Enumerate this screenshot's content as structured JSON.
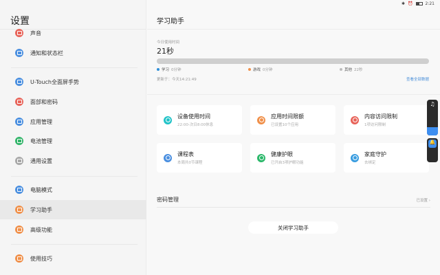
{
  "status": {
    "time": "2:21",
    "icons": [
      "wifi-icon",
      "app-icon",
      "app-icon",
      "app-icon"
    ],
    "right_icons": [
      "bluetooth-icon",
      "alarm-icon",
      "battery-icon"
    ]
  },
  "sidebar": {
    "title": "设置",
    "items": [
      {
        "label": "声音",
        "color": "#e8645a"
      },
      {
        "label": "通知和状态栏",
        "color": "#4a8fe0"
      },
      {
        "label": "U-Touch全面屏手势",
        "color": "#4a8fe0"
      },
      {
        "label": "面部和密码",
        "color": "#e8645a"
      },
      {
        "label": "应用管理",
        "color": "#4a8fe0"
      },
      {
        "label": "电池管理",
        "color": "#33b56a"
      },
      {
        "label": "通用设置",
        "color": "#a8a8a8"
      },
      {
        "label": "电脑模式",
        "color": "#4a8fe0"
      },
      {
        "label": "学习助手",
        "color": "#f0904a"
      },
      {
        "label": "高级功能",
        "color": "#f0904a"
      },
      {
        "label": "使用技巧",
        "color": "#f0904a"
      }
    ]
  },
  "main": {
    "title": "学习助手",
    "usage_label": "今日使用时间",
    "usage_value": "21秒",
    "usage_progress": 0,
    "legend": [
      {
        "name": "学习",
        "value": "0分钟",
        "color": "#2f8fd8"
      },
      {
        "name": "游戏",
        "value": "0分钟",
        "color": "#f0904a"
      },
      {
        "name": "其他",
        "value": "22秒",
        "color": "#bbbbbb"
      }
    ],
    "updated": "更新于：今天14:21:49",
    "view_all": "查看全部数据",
    "cards": [
      {
        "title": "设备使用时间",
        "sub": "22:00-次日8:00休息",
        "color": "#22c3c8"
      },
      {
        "title": "应用时间限额",
        "sub": "已设置10个应用",
        "color": "#f0904a"
      },
      {
        "title": "内容访问限制",
        "sub": "1项访问限制",
        "color": "#e8645a"
      },
      {
        "title": "课程表",
        "sub": "本周共0节课程",
        "color": "#4a8fe0"
      },
      {
        "title": "健康护眼",
        "sub": "已开启3项护眼功能",
        "color": "#2bb86a"
      },
      {
        "title": "家庭守护",
        "sub": "去绑定",
        "color": "#3a9de0"
      }
    ],
    "password_label": "密码管理",
    "password_status": "已设置",
    "close_button": "关闭学习助手"
  }
}
